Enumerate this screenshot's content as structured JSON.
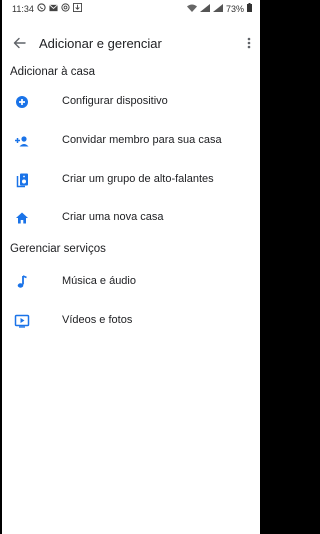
{
  "status_bar": {
    "time": "11:34",
    "battery": "73%"
  },
  "app_bar": {
    "title": "Adicionar e gerenciar"
  },
  "sections": [
    {
      "header": "Adicionar à casa",
      "items": [
        {
          "label": "Configurar dispositivo",
          "icon": "add-circle-icon"
        },
        {
          "label": "Convidar membro para sua casa",
          "icon": "person-add-icon"
        },
        {
          "label": "Criar um grupo de alto-falantes",
          "icon": "speaker-group-icon"
        },
        {
          "label": "Criar uma nova casa",
          "icon": "home-icon"
        }
      ]
    },
    {
      "header": "Gerenciar serviços",
      "items": [
        {
          "label": "Música e áudio",
          "icon": "music-note-icon"
        },
        {
          "label": "Vídeos e fotos",
          "icon": "video-icon"
        }
      ]
    }
  ],
  "colors": {
    "accent": "#1a73e8",
    "text": "#202124"
  }
}
